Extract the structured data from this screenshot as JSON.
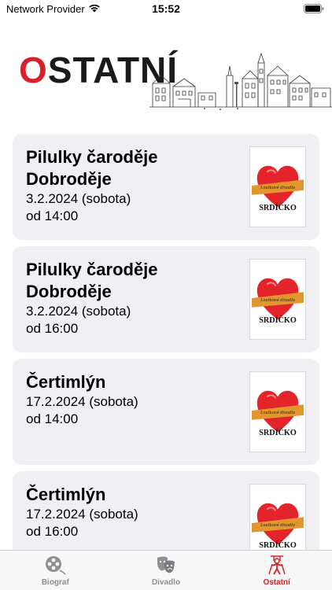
{
  "status_bar": {
    "provider": "Network Provider",
    "time": "15:52"
  },
  "header": {
    "title_first_letter": "O",
    "title_rest": "STATNÍ",
    "accent_color": "#d8202a"
  },
  "events": [
    {
      "title": "Pilulky čaroděje Dobroděje",
      "date": "3.2.2024 (sobota)",
      "time": "od 14:00",
      "poster_text": "SRDÍČKO",
      "poster_ribbon": "Loutkové divadlo"
    },
    {
      "title": "Pilulky čaroděje Dobroděje",
      "date": "3.2.2024 (sobota)",
      "time": "od 16:00",
      "poster_text": "SRDÍČKO",
      "poster_ribbon": "Loutkové divadlo"
    },
    {
      "title": "Čertimlýn",
      "date": "17.2.2024 (sobota)",
      "time": "od 14:00",
      "poster_text": "SRDÍČKO",
      "poster_ribbon": "Loutkové divadlo"
    },
    {
      "title": "Čertimlýn",
      "date": "17.2.2024 (sobota)",
      "time": "od 16:00",
      "poster_text": "SRDÍČKO",
      "poster_ribbon": "Loutkové divadlo"
    }
  ],
  "tabbar": {
    "tabs": [
      {
        "label": "Biograf",
        "icon": "film-reel-icon",
        "active": false
      },
      {
        "label": "Divadlo",
        "icon": "theater-masks-icon",
        "active": false
      },
      {
        "label": "Ostatní",
        "icon": "puppet-icon",
        "active": true
      }
    ],
    "active_color": "#d8202a",
    "inactive_color": "#8e8e93"
  }
}
